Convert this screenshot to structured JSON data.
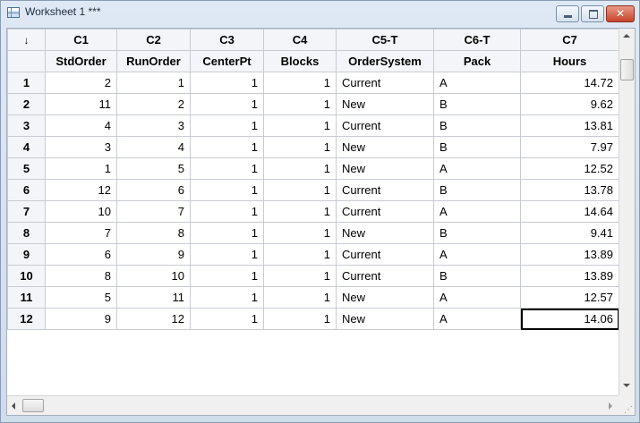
{
  "window": {
    "title": "Worksheet 1 ***",
    "close_glyph": "✕"
  },
  "corner": {
    "glyph": "↓"
  },
  "columns": [
    {
      "id": "C1",
      "name": "StdOrder",
      "align": "num"
    },
    {
      "id": "C2",
      "name": "RunOrder",
      "align": "num"
    },
    {
      "id": "C3",
      "name": "CenterPt",
      "align": "num"
    },
    {
      "id": "C4",
      "name": "Blocks",
      "align": "num"
    },
    {
      "id": "C5-T",
      "name": "OrderSystem",
      "align": "txt"
    },
    {
      "id": "C6-T",
      "name": "Pack",
      "align": "txt"
    },
    {
      "id": "C7",
      "name": "Hours",
      "align": "num"
    }
  ],
  "rows": [
    {
      "num": "1",
      "cells": [
        "2",
        "1",
        "1",
        "1",
        "Current",
        "A",
        "14.72"
      ]
    },
    {
      "num": "2",
      "cells": [
        "11",
        "2",
        "1",
        "1",
        "New",
        "B",
        "9.62"
      ]
    },
    {
      "num": "3",
      "cells": [
        "4",
        "3",
        "1",
        "1",
        "Current",
        "B",
        "13.81"
      ]
    },
    {
      "num": "4",
      "cells": [
        "3",
        "4",
        "1",
        "1",
        "New",
        "B",
        "7.97"
      ]
    },
    {
      "num": "5",
      "cells": [
        "1",
        "5",
        "1",
        "1",
        "New",
        "A",
        "12.52"
      ]
    },
    {
      "num": "6",
      "cells": [
        "12",
        "6",
        "1",
        "1",
        "Current",
        "B",
        "13.78"
      ]
    },
    {
      "num": "7",
      "cells": [
        "10",
        "7",
        "1",
        "1",
        "Current",
        "A",
        "14.64"
      ]
    },
    {
      "num": "8",
      "cells": [
        "7",
        "8",
        "1",
        "1",
        "New",
        "B",
        "9.41"
      ]
    },
    {
      "num": "9",
      "cells": [
        "6",
        "9",
        "1",
        "1",
        "Current",
        "A",
        "13.89"
      ]
    },
    {
      "num": "10",
      "cells": [
        "8",
        "10",
        "1",
        "1",
        "Current",
        "B",
        "13.89"
      ]
    },
    {
      "num": "11",
      "cells": [
        "5",
        "11",
        "1",
        "1",
        "New",
        "A",
        "12.57"
      ]
    },
    {
      "num": "12",
      "cells": [
        "9",
        "12",
        "1",
        "1",
        "New",
        "A",
        "14.06"
      ]
    }
  ],
  "selected_cell": {
    "row": "12",
    "column": "C7"
  },
  "colors": {
    "title_bar": "#dfe9f5",
    "header_bg": "#f3f5f8",
    "grid_line": "#c8ccd2",
    "close_button": "#c6452b"
  }
}
